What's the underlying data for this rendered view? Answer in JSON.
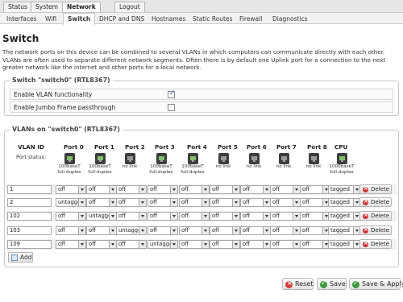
{
  "top_nav": [
    "Status",
    "System",
    "Network",
    "Logout"
  ],
  "sub_nav": [
    "Interfaces",
    "Wifi",
    "Switch",
    "DHCP and DNS",
    "Hostnames",
    "Static Routes",
    "Firewall",
    "Diagnostics"
  ],
  "active_top": "Network",
  "active_sub": "Switch",
  "page_title": "Switch",
  "description": "The network ports on this device can be combined to several VLANs in which computers can communicate directly with each other. VLANs are often used to separate different network segments. Often there is by default one Uplink port for a connection to the next greater network like the internet and other ports for a local network.",
  "switch_section": {
    "legend": "Switch \"switch0\" (RTL8367)",
    "options": [
      {
        "label": "Enable VLAN functionality",
        "checked": true
      },
      {
        "label": "Enable Jumbo Frame passthrough",
        "checked": false
      }
    ]
  },
  "vlan_section": {
    "legend": "VLANs on \"switch0\" (RTL8367)",
    "headers": [
      "VLAN ID",
      "Port 0",
      "Port 1",
      "Port 2",
      "Port 3",
      "Port 4",
      "Port 5",
      "Port 6",
      "Port 7",
      "Port 8",
      "CPU"
    ],
    "port_status_label": "Port status:",
    "port_status": [
      {
        "line1": "100baseT",
        "line2": "full-duplex",
        "link": true
      },
      {
        "line1": "100baseT",
        "line2": "full-duplex",
        "link": true
      },
      {
        "line1": "no link",
        "line2": "",
        "link": false
      },
      {
        "line1": "100baseT",
        "line2": "full-duplex",
        "link": true
      },
      {
        "line1": "100baseT",
        "line2": "full-duplex",
        "link": true
      },
      {
        "line1": "no link",
        "line2": "",
        "link": false
      },
      {
        "line1": "no link",
        "line2": "",
        "link": false
      },
      {
        "line1": "no link",
        "line2": "",
        "link": false
      },
      {
        "line1": "no link",
        "line2": "",
        "link": false
      },
      {
        "line1": "1000baseT",
        "line2": "full-duplex",
        "link": true
      }
    ],
    "rows": [
      {
        "vlan_id": "1",
        "ports": [
          "off",
          "off",
          "off",
          "off",
          "off",
          "off",
          "off",
          "off",
          "off",
          "tagged"
        ]
      },
      {
        "vlan_id": "2",
        "ports": [
          "untagged",
          "off",
          "off",
          "off",
          "off",
          "off",
          "off",
          "off",
          "off",
          "tagged"
        ]
      },
      {
        "vlan_id": "102",
        "ports": [
          "off",
          "untagged",
          "off",
          "off",
          "off",
          "off",
          "off",
          "off",
          "off",
          "tagged"
        ]
      },
      {
        "vlan_id": "103",
        "ports": [
          "off",
          "off",
          "untagged",
          "off",
          "off",
          "off",
          "off",
          "off",
          "off",
          "tagged"
        ]
      },
      {
        "vlan_id": "109",
        "ports": [
          "off",
          "off",
          "off",
          "untagged",
          "off",
          "off",
          "off",
          "off",
          "off",
          "tagged"
        ]
      }
    ],
    "delete_label": "Delete",
    "add_label": "Add"
  },
  "actions": {
    "reset": "Reset",
    "save": "Save",
    "save_apply": "Save & Apply"
  },
  "colors": {
    "link_up": "#82c06c",
    "delete_icon": "#cc3333",
    "save_icon": "#3e9a3e"
  }
}
